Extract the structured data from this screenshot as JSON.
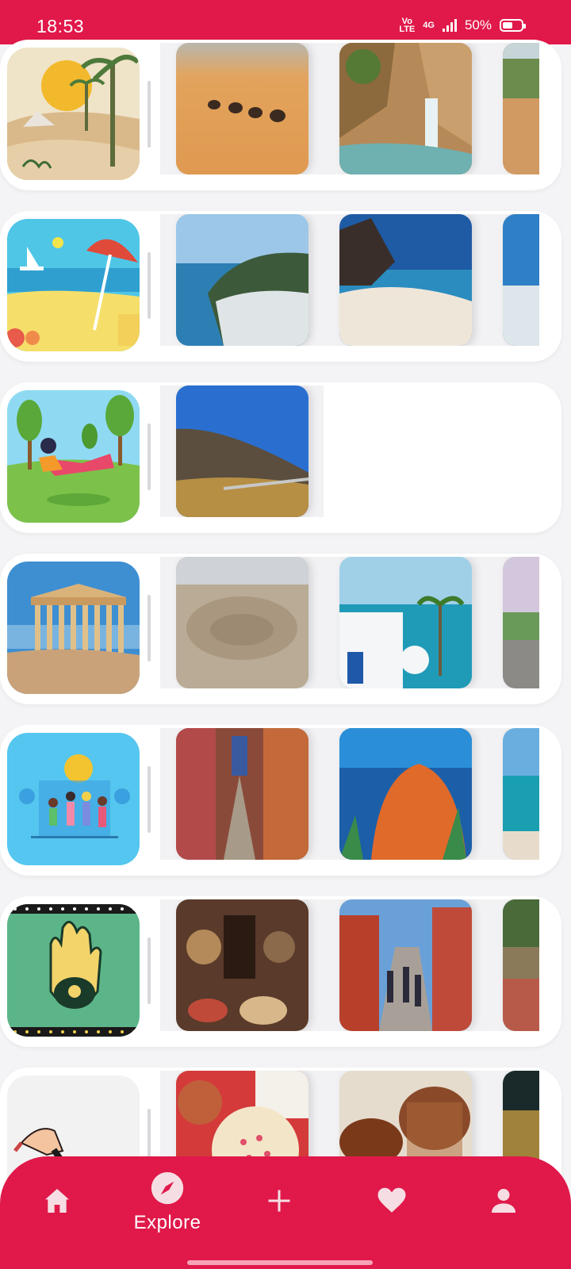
{
  "status_bar": {
    "time": "18:53",
    "volte": "Vo LTE",
    "network": "4G",
    "battery_text": "50%",
    "battery_level": 0.5
  },
  "colors": {
    "accent": "#e0194a",
    "background": "#f4f4f6",
    "card": "#ffffff"
  },
  "categories": [
    {
      "name": "desert-category",
      "photo_count": 3
    },
    {
      "name": "beach-category",
      "photo_count": 3
    },
    {
      "name": "nature-category",
      "photo_count": 1
    },
    {
      "name": "history-category",
      "photo_count": 3
    },
    {
      "name": "activities-category",
      "photo_count": 3
    },
    {
      "name": "crafts-category",
      "photo_count": 3
    },
    {
      "name": "food-category",
      "photo_count": 3
    }
  ],
  "bottom_nav": {
    "items": [
      {
        "icon": "home-icon",
        "label": ""
      },
      {
        "icon": "compass-icon",
        "label": "Explore",
        "active": true
      },
      {
        "icon": "plus-icon",
        "label": ""
      },
      {
        "icon": "heart-icon",
        "label": ""
      },
      {
        "icon": "profile-icon",
        "label": ""
      }
    ]
  }
}
